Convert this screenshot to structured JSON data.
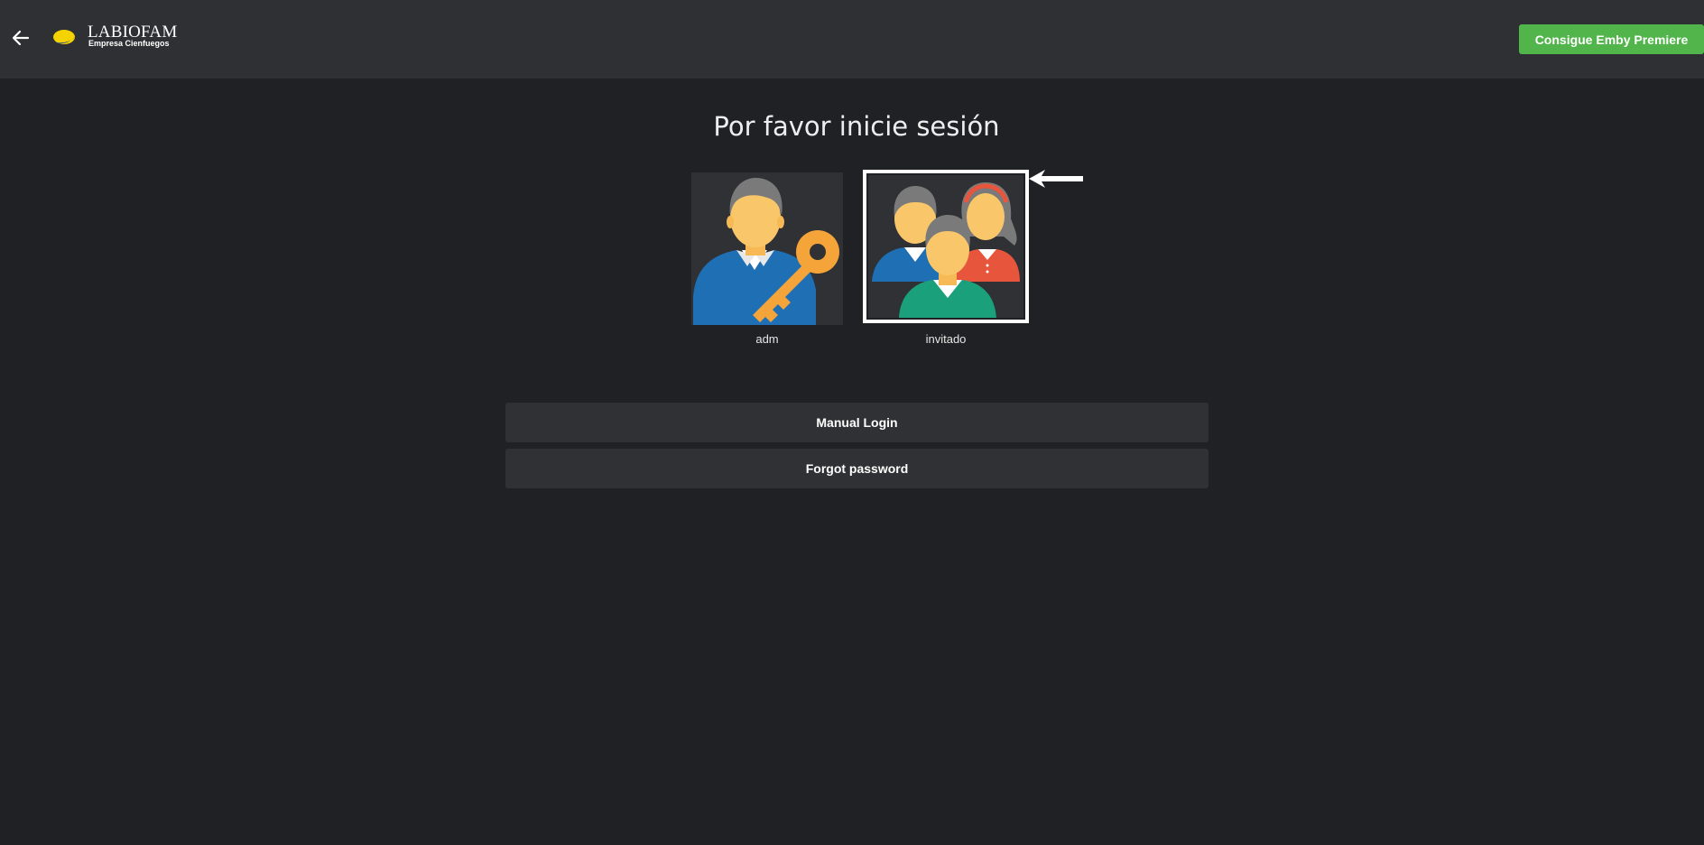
{
  "header": {
    "back_icon": "arrow-left-icon",
    "logo": {
      "name": "LABIOFAM",
      "subtitle": "Empresa Cienfuegos",
      "colors": {
        "yellow": "#f5d300",
        "blue": "#1a3f9c"
      }
    },
    "premiere_label": "Consigue Emby Premiere",
    "premiere_color": "#52b54b"
  },
  "main": {
    "title": "Por favor inicie sesión",
    "users": [
      {
        "name": "adm",
        "icon": "admin-user-key-icon",
        "selected": false
      },
      {
        "name": "invitado",
        "icon": "user-group-icon",
        "selected": true
      }
    ],
    "annotation_icon": "arrow-left-icon",
    "buttons": {
      "manual_login": "Manual Login",
      "forgot_password": "Forgot password"
    }
  },
  "colors": {
    "background": "#202124",
    "header": "#2f3033",
    "card": "#303134",
    "accent": "#52b54b"
  }
}
